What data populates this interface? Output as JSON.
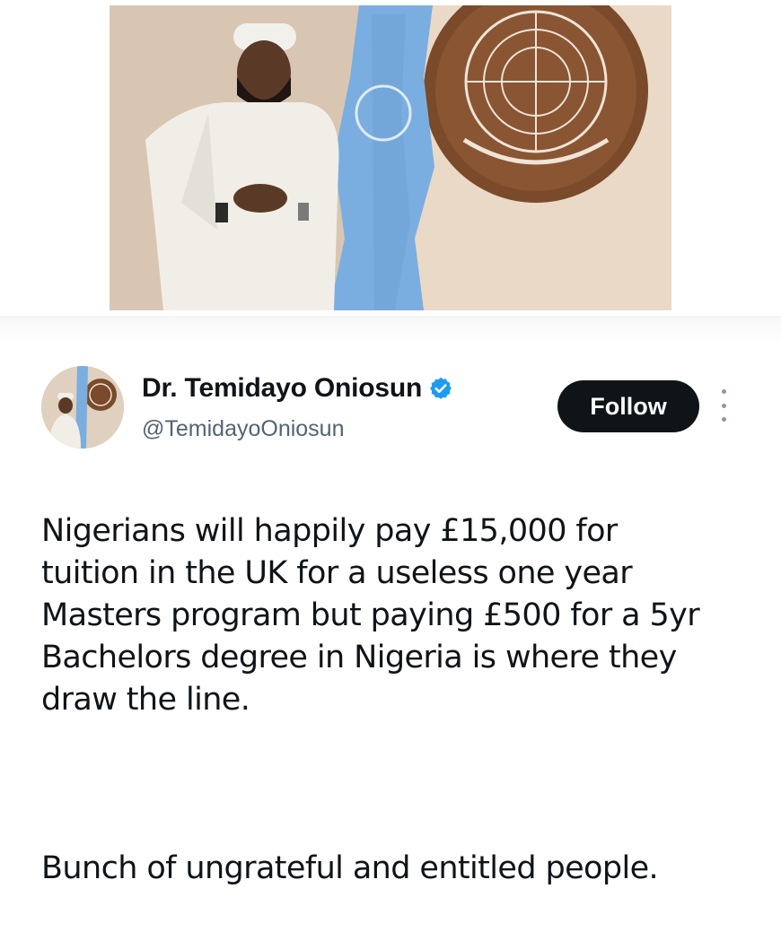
{
  "photo": {
    "alt_icon": "photo-of-man-beside-un-flag-and-emblem"
  },
  "tweet": {
    "author": {
      "display_name": "Dr. Temidayo Oniosun",
      "handle": "@TemidayoOniosun",
      "verified": true,
      "verified_color": "#1d9bf0",
      "avatar_icon": "avatar"
    },
    "follow_label": "Follow",
    "more_icon": "more-options-icon",
    "paragraphs": [
      "Nigerians will happily pay £15,000 for\ntuition in the UK for a useless one year\nMasters program but paying £500 for a 5yr\nBachelors degree in Nigeria is where they\ndraw the line.",
      "Bunch of ungrateful and entitled people."
    ]
  },
  "colors": {
    "text": "#0f1419",
    "secondary": "#536471",
    "button_bg": "#0f1419",
    "button_text": "#ffffff"
  }
}
